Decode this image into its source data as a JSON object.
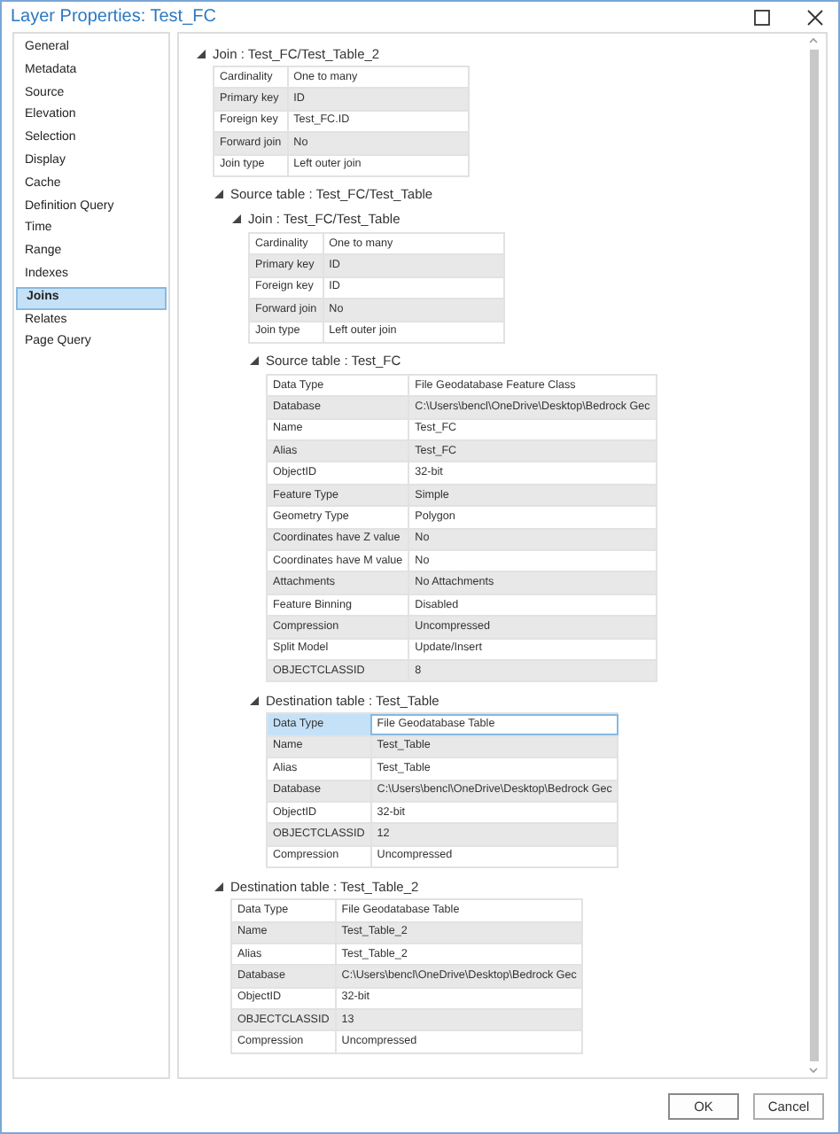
{
  "window": {
    "title": "Layer Properties: Test_FC"
  },
  "sidebar": {
    "items": [
      {
        "label": "General",
        "selected": false
      },
      {
        "label": "Metadata",
        "selected": false
      },
      {
        "label": "Source",
        "selected": false
      },
      {
        "label": "Elevation",
        "selected": false
      },
      {
        "label": "Selection",
        "selected": false
      },
      {
        "label": "Display",
        "selected": false
      },
      {
        "label": "Cache",
        "selected": false
      },
      {
        "label": "Definition Query",
        "selected": false
      },
      {
        "label": "Time",
        "selected": false
      },
      {
        "label": "Range",
        "selected": false
      },
      {
        "label": "Indexes",
        "selected": false
      },
      {
        "label": "Joins",
        "selected": true
      },
      {
        "label": "Relates",
        "selected": false
      },
      {
        "label": "Page Query",
        "selected": false
      }
    ]
  },
  "tree": [
    {
      "heading": "Join : Test_FC/Test_Table_2",
      "expanded": true,
      "rows": [
        {
          "key": "Cardinality",
          "value": "One to many",
          "selected": false
        },
        {
          "key": "Primary key",
          "value": "ID",
          "selected": false
        },
        {
          "key": "Foreign key",
          "value": "Test_FC.ID",
          "selected": false
        },
        {
          "key": "Forward join",
          "value": "No",
          "selected": false
        },
        {
          "key": "Join type",
          "value": "Left outer join",
          "selected": false
        }
      ],
      "children": [
        {
          "heading": "Source table : Test_FC/Test_Table",
          "expanded": true,
          "children": [
            {
              "heading": "Join : Test_FC/Test_Table",
              "expanded": true,
              "rows": [
                {
                  "key": "Cardinality",
                  "value": "One to many",
                  "selected": false
                },
                {
                  "key": "Primary key",
                  "value": "ID",
                  "selected": false
                },
                {
                  "key": "Foreign key",
                  "value": "ID",
                  "selected": false
                },
                {
                  "key": "Forward join",
                  "value": "No",
                  "selected": false
                },
                {
                  "key": "Join type",
                  "value": "Left outer join",
                  "selected": false
                }
              ],
              "children": [
                {
                  "heading": "Source table : Test_FC",
                  "expanded": true,
                  "rows": [
                    {
                      "key": "Data Type",
                      "value": "File Geodatabase Feature Class",
                      "selected": false
                    },
                    {
                      "key": "Database",
                      "value": "C:\\Users\\bencl\\OneDrive\\Desktop\\Bedrock Gec",
                      "selected": false
                    },
                    {
                      "key": "Name",
                      "value": "Test_FC",
                      "selected": false
                    },
                    {
                      "key": "Alias",
                      "value": "Test_FC",
                      "selected": false
                    },
                    {
                      "key": "ObjectID",
                      "value": "32-bit",
                      "selected": false
                    },
                    {
                      "key": "Feature Type",
                      "value": "Simple",
                      "selected": false
                    },
                    {
                      "key": "Geometry Type",
                      "value": "Polygon",
                      "selected": false
                    },
                    {
                      "key": "Coordinates have Z value",
                      "value": "No",
                      "selected": false
                    },
                    {
                      "key": "Coordinates have M value",
                      "value": "No",
                      "selected": false
                    },
                    {
                      "key": "Attachments",
                      "value": "No Attachments",
                      "selected": false
                    },
                    {
                      "key": "Feature Binning",
                      "value": "Disabled",
                      "selected": false
                    },
                    {
                      "key": "Compression",
                      "value": "Uncompressed",
                      "selected": false
                    },
                    {
                      "key": "Split Model",
                      "value": "Update/Insert",
                      "selected": false
                    },
                    {
                      "key": "OBJECTCLASSID",
                      "value": "8",
                      "selected": false
                    }
                  ]
                },
                {
                  "heading": "Destination table : Test_Table",
                  "expanded": true,
                  "rows": [
                    {
                      "key": "Data Type",
                      "value": "File Geodatabase Table",
                      "selected": true
                    },
                    {
                      "key": "Name",
                      "value": "Test_Table",
                      "selected": false
                    },
                    {
                      "key": "Alias",
                      "value": "Test_Table",
                      "selected": false
                    },
                    {
                      "key": "Database",
                      "value": "C:\\Users\\bencl\\OneDrive\\Desktop\\Bedrock Gec",
                      "selected": false
                    },
                    {
                      "key": "ObjectID",
                      "value": "32-bit",
                      "selected": false
                    },
                    {
                      "key": "OBJECTCLASSID",
                      "value": "12",
                      "selected": false
                    },
                    {
                      "key": "Compression",
                      "value": "Uncompressed",
                      "selected": false
                    }
                  ]
                }
              ]
            }
          ]
        },
        {
          "heading": "Destination table : Test_Table_2",
          "expanded": true,
          "rows": [
            {
              "key": "Data Type",
              "value": "File Geodatabase Table",
              "selected": false
            },
            {
              "key": "Name",
              "value": "Test_Table_2",
              "selected": false
            },
            {
              "key": "Alias",
              "value": "Test_Table_2",
              "selected": false
            },
            {
              "key": "Database",
              "value": "C:\\Users\\bencl\\OneDrive\\Desktop\\Bedrock Gec",
              "selected": false
            },
            {
              "key": "ObjectID",
              "value": "32-bit",
              "selected": false
            },
            {
              "key": "OBJECTCLASSID",
              "value": "13",
              "selected": false
            },
            {
              "key": "Compression",
              "value": "Uncompressed",
              "selected": false
            }
          ]
        }
      ]
    }
  ],
  "buttons": [
    {
      "label": "OK",
      "kind": "primary"
    },
    {
      "label": "Cancel",
      "kind": "secondary"
    }
  ]
}
